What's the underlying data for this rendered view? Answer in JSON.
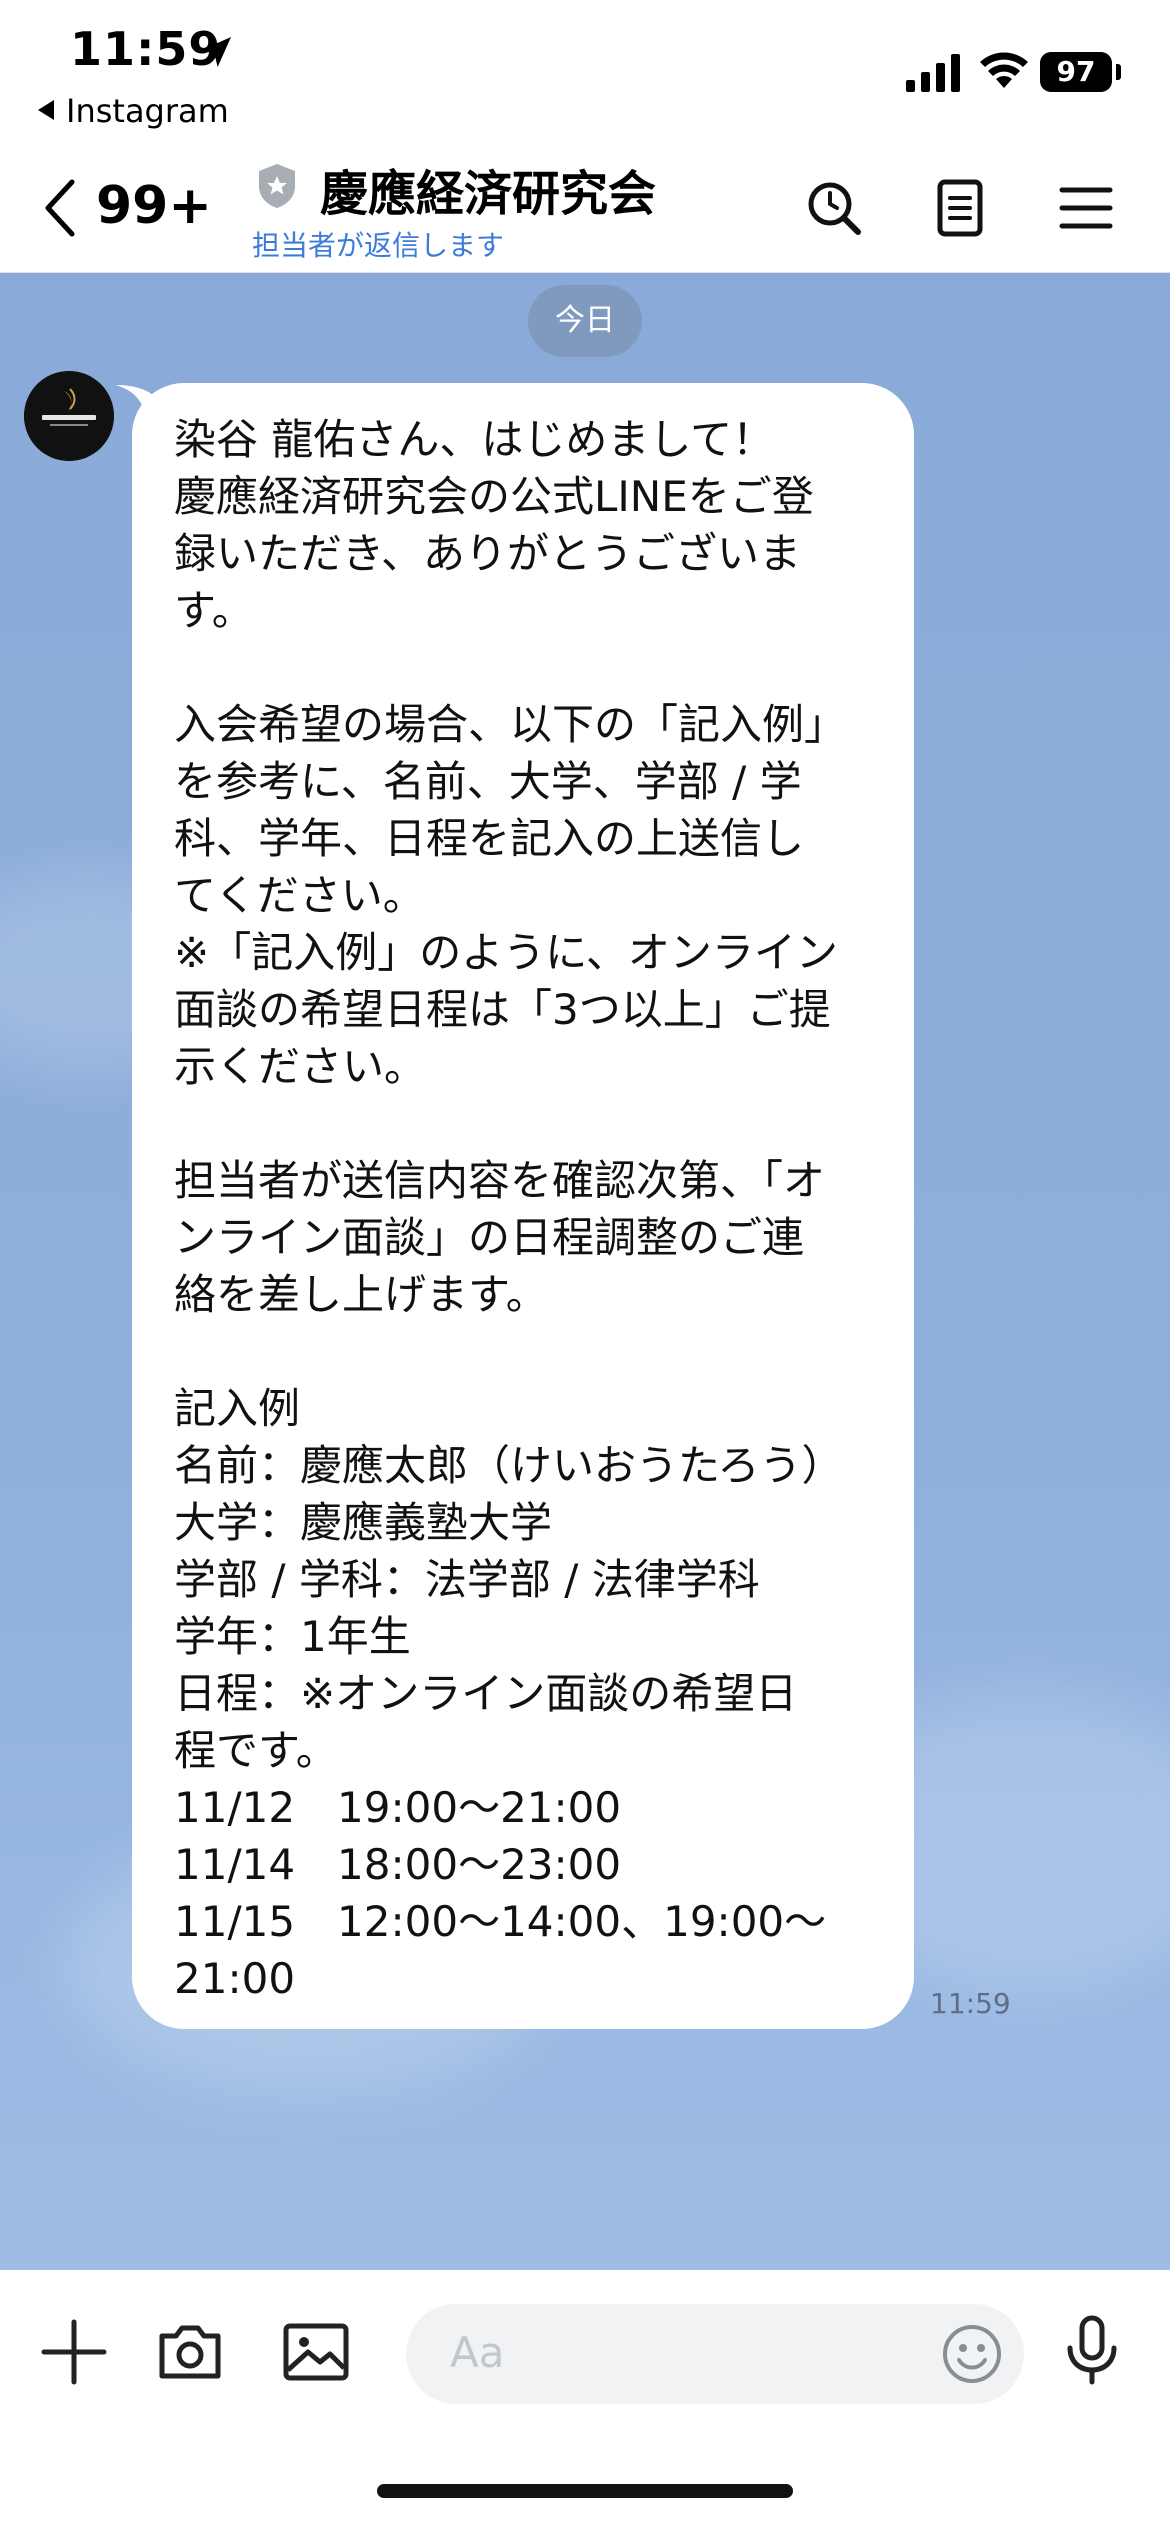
{
  "status_bar": {
    "time": "11:59",
    "back_app": "Instagram",
    "battery": "97",
    "icons": [
      "location-arrow-icon",
      "signal-icon",
      "wifi-icon",
      "battery-icon"
    ]
  },
  "header": {
    "unread_count": "99+",
    "title": "慶應経済研究会",
    "subtitle": "担当者が返信します",
    "icons": [
      "back-chevron-icon",
      "shield-icon",
      "search-icon",
      "notes-icon",
      "menu-icon"
    ]
  },
  "chat": {
    "date_separator": "今日",
    "messages": [
      {
        "sender_avatar": "avatar",
        "time": "11:59",
        "text": "染谷 龍佑さん、はじめまして！\n慶應経済研究会の公式LINEをご登\n録いただき、ありがとうございま\nす。\n\n入会希望の場合、以下の「記入例」\nを参考に、名前、大学、学部 / 学\n科、学年、日程を記入の上送信し\nてください。\n※「記入例」のように、オンライン\n面談の希望日程は「3つ以上」ご提\n示ください。\n\n担当者が送信内容を確認次第、「オ\nンライン面談」の日程調整のご連\n絡を差し上げます。\n\n記入例\n名前：慶應太郎（けいおうたろう）\n大学：慶應義塾大学\n学部 / 学科：法学部 / 法律学科\n学年：1年生\n日程：※オンライン面談の希望日\n程です。\n11/12　19:00～21:00\n11/14　18:00～23:00\n11/15　12:00～14:00、19:00～\n21:00"
      }
    ]
  },
  "input_bar": {
    "placeholder": "Aa",
    "icons": [
      "plus-icon",
      "camera-icon",
      "image-icon",
      "emoji-icon",
      "microphone-icon"
    ]
  },
  "colors": {
    "chat_background": "#8aabd9",
    "subtitle_blue": "#3d7bd9",
    "bubble": "#ffffff"
  }
}
